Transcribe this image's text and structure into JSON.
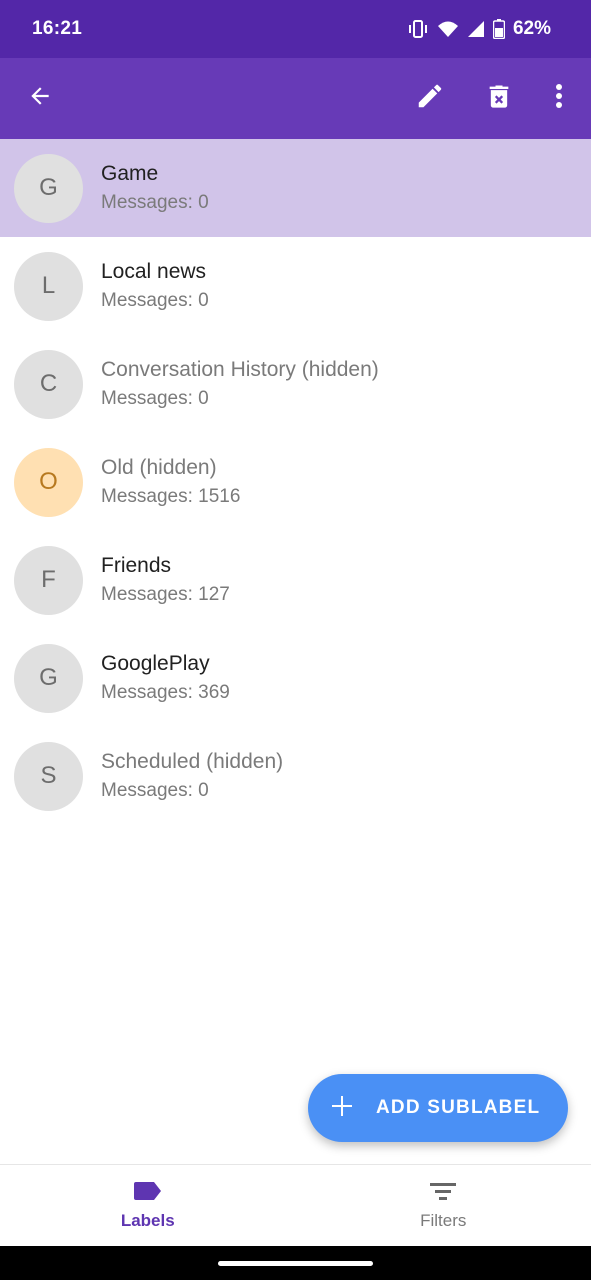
{
  "status_bar": {
    "time": "16:21",
    "battery": "62%"
  },
  "app_bar": {
    "back_icon": "arrow-back-icon",
    "edit_icon": "pencil-icon",
    "delete_icon": "delete-icon",
    "more_icon": "more-vert-icon"
  },
  "labels": [
    {
      "initial": "G",
      "name": "Game",
      "messages": "Messages: 0",
      "selected": true,
      "hidden": false
    },
    {
      "initial": "L",
      "name": "Local news",
      "messages": "Messages: 0",
      "selected": false,
      "hidden": false
    },
    {
      "initial": "C",
      "name": "Conversation History (hidden)",
      "messages": "Messages: 0",
      "selected": false,
      "hidden": true
    },
    {
      "initial": "O",
      "name": "Old (hidden)",
      "messages": "Messages: 1516",
      "selected": false,
      "hidden": true
    },
    {
      "initial": "F",
      "name": "Friends",
      "messages": "Messages: 127",
      "selected": false,
      "hidden": false
    },
    {
      "initial": "G",
      "name": "GooglePlay",
      "messages": "Messages: 369",
      "selected": false,
      "hidden": false
    },
    {
      "initial": "S",
      "name": "Scheduled (hidden)",
      "messages": "Messages: 0",
      "selected": false,
      "hidden": true
    }
  ],
  "fab": {
    "label": "ADD SUBLABEL",
    "icon": "plus-icon"
  },
  "bottom_nav": {
    "labels_tab": "Labels",
    "filters_tab": "Filters"
  },
  "colors": {
    "status_bar": "#5327a8",
    "app_bar": "#673ab7",
    "selected_row": "#d1c4e9",
    "fab": "#4a90f5",
    "active_tab": "#5e35b1",
    "orange_avatar": "#ffe0b2"
  }
}
